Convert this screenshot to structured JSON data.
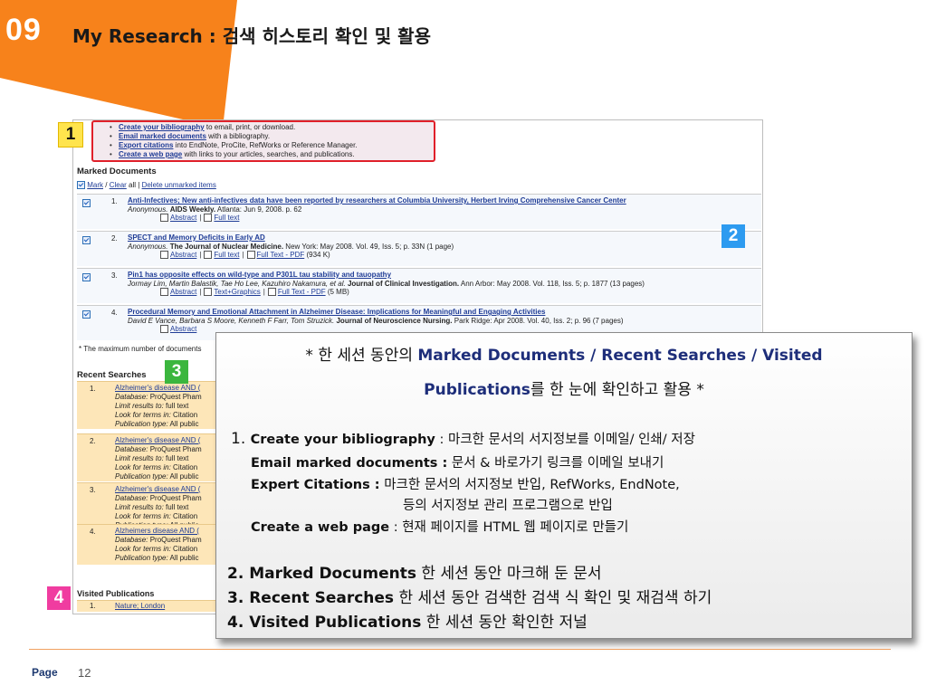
{
  "slide": {
    "number": "09",
    "title": "My Research : 검색 히스토리 확인 및 활용",
    "page_label": "Page",
    "page_number": "12",
    "colors": {
      "accent": "#f7821b",
      "badge1": "#ffe44d",
      "badge2": "#2d9bf0",
      "badge3": "#3bb63e",
      "badge4": "#f03ca0",
      "link": "#1f3c96"
    }
  },
  "badges": [
    "1",
    "2",
    "3",
    "4"
  ],
  "shot": {
    "links": [
      {
        "link": "Create your bibliography",
        "rest": " to email, print, or download."
      },
      {
        "link": "Email marked documents",
        "rest": " with a bibliography."
      },
      {
        "link": "Export citations",
        "rest": " into EndNote, ProCite, RefWorks or Reference Manager."
      },
      {
        "link": "Create a web page",
        "rest": " with links to your articles, searches, and publications."
      }
    ],
    "marked_heading": "Marked Documents",
    "mark_bar": {
      "mark": "Mark",
      "sep1": " / ",
      "clear": "Clear",
      "all": " all | ",
      "delete": "Delete unmarked items"
    },
    "docs": [
      {
        "num": "1.",
        "title": "Anti-Infectives; New anti-infectives data have been reported by researchers at Columbia University, Herbert Irving Comprehensive Cancer Center",
        "authors": "Anonymous.",
        "journal": "AIDS Weekly.",
        "rest": " Atlanta: Jun 9, 2008. p. 62",
        "l1": "Abstract",
        "l2": "Full text",
        "l3": "",
        "l3size": ""
      },
      {
        "num": "2.",
        "title": "SPECT and Memory Deficits in Early AD",
        "authors": "Anonymous.",
        "journal": "The Journal of Nuclear Medicine.",
        "rest": " New York: May 2008. Vol. 49, Iss. 5; p. 33N (1 page)",
        "l1": "Abstract",
        "l2": "Full text",
        "l3": "Full Text - PDF",
        "l3size": " (934 K)"
      },
      {
        "num": "3.",
        "title": "Pin1 has opposite effects on wild-type and P301L tau stability and tauopathy",
        "authors": "Jormay Lim, Martin Balastik, Tae Ho Lee, Kazuhiro Nakamura, et al.",
        "journal": "Journal of Clinical Investigation.",
        "rest": " Ann Arbor: May 2008. Vol. 118, Iss. 5; p. 1877 (13 pages)",
        "l1": "Abstract",
        "l2": "Text+Graphics",
        "l3": "Full Text - PDF",
        "l3size": " (5 MB)"
      },
      {
        "num": "4.",
        "title": "Procedural Memory and Emotional Attachment in Alzheimer Disease: Implications for Meaningful and Engaging Activities",
        "authors": "David E Vance, Barbara S Moore, Kenneth F Farr, Tom Struzick.",
        "journal": "Journal of Neuroscience Nursing.",
        "rest": " Park Ridge: Apr 2008. Vol. 40, Iss. 2; p. 96 (7 pages)",
        "l1": "Abstract",
        "l2": "",
        "l3": "",
        "l3size": ""
      }
    ],
    "note": "* The maximum number of documents",
    "recent_heading": "Recent Searches",
    "searches": [
      {
        "num": "1.",
        "query": "Alzheimer's disease AND (",
        "db_label": "Database:",
        "db": " ProQuest Pham",
        "limit_label": "Limit results to:",
        "limit": " full text",
        "look_label": "Look for terms in:",
        "look": " Citation",
        "pub_label": "Publication type:",
        "pub": " All public"
      },
      {
        "num": "2.",
        "query": "Alzheimer's disease AND (",
        "db_label": "Database:",
        "db": " ProQuest Pham",
        "limit_label": "Limit results to:",
        "limit": " full text",
        "look_label": "Look for terms in:",
        "look": " Citation",
        "pub_label": "Publication type:",
        "pub": " All public"
      },
      {
        "num": "3.",
        "query": "Alzheimer's disease AND (",
        "db_label": "Database:",
        "db": " ProQuest Pham",
        "limit_label": "Limit results to:",
        "limit": " full text",
        "look_label": "Look for terms in:",
        "look": " Citation",
        "pub_label": "Publication type:",
        "pub": " All public"
      },
      {
        "num": "4.",
        "query": "Alzheimers disease AND (",
        "db_label": "Database:",
        "db": " ProQuest Pham",
        "limit_label": "Look for terms in:",
        "limit": " Citation",
        "look_label": "Publication type:",
        "look": " All public",
        "pub_label": "",
        "pub": ""
      }
    ],
    "visited_heading": "Visited Publications",
    "visited": [
      {
        "num": "1.",
        "name": "Nature; London"
      }
    ]
  },
  "callout": {
    "head1_pre": "* 한 세션 동안의 ",
    "head1_bold": "Marked Documents / Recent Searches / Visited",
    "head2_bold": "Publications",
    "head2_post": "를 한 눈에 확인하고 활용 *",
    "item1_num": "1. ",
    "item1_key": "Create your bibliography",
    "item1_desc": " : 마크한 문서의 서지정보를 이메일/ 인쇄/ 저장",
    "item1b_key": "Email marked documents :",
    "item1b_desc": " 문서 & 바로가기 링크를 이메일 보내기",
    "item1c_key": "Expert Citations :",
    "item1c_desc": " 마크한 문서의 서지정보 반입, RefWorks, EndNote,",
    "item1c_cont": "등의 서지정보 관리 프로그램으로 반입",
    "item1d_key": "Create a web page",
    "item1d_desc": " : 현재 페이지를 HTML 웹 페이지로 만들기",
    "item2_key": "2. Marked Documents",
    "item2_desc": " 한 세션 동안 마크해 둔 문서",
    "item3_key": "3. Recent Searches",
    "item3_desc": " 한 세션 동안 검색한 검색 식 확인 및 재검색 하기",
    "item4_key": "4. Visited Publications",
    "item4_desc": " 한 세션 동안 확인한 저널"
  }
}
